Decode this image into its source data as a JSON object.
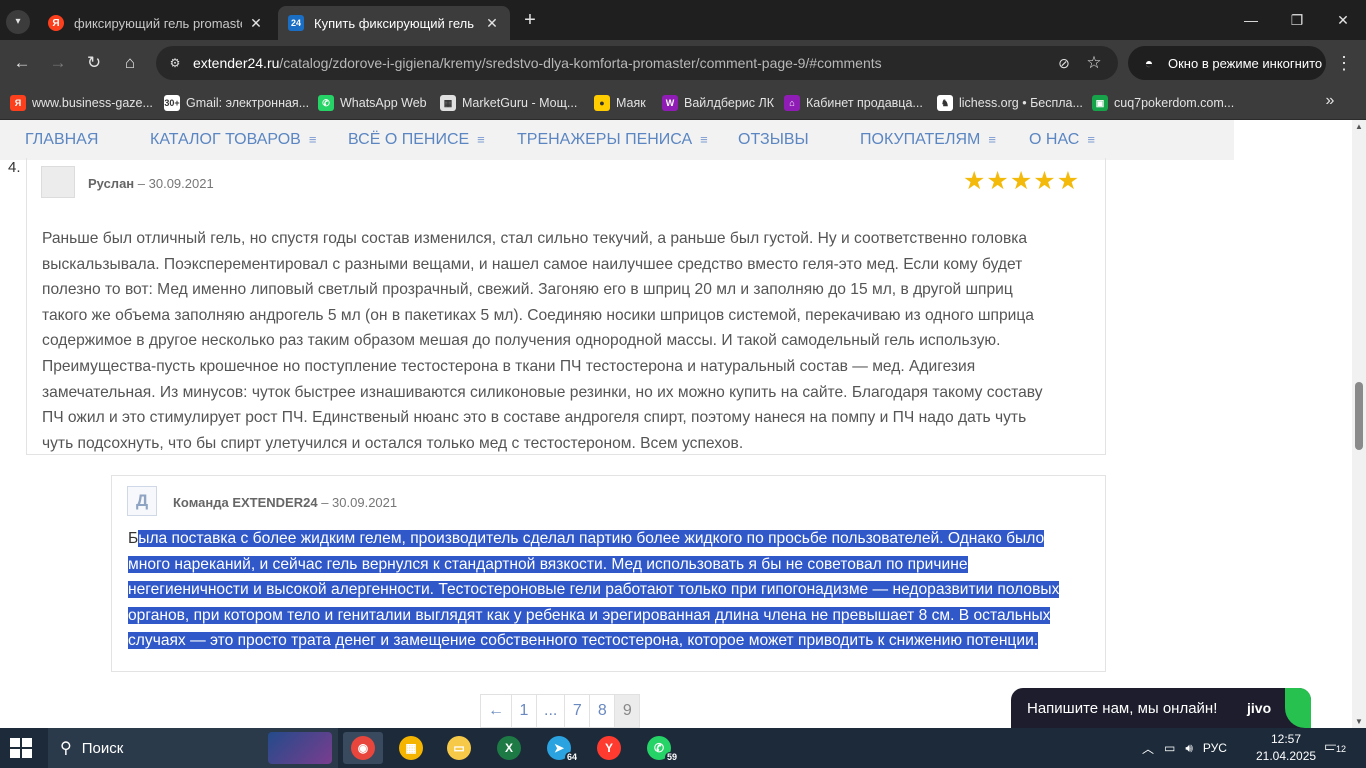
{
  "browser": {
    "tabs": [
      {
        "title": "фиксирующий гель promaster",
        "favicon": "Я",
        "active": false
      },
      {
        "title": "Купить фиксирующий гель Pro",
        "favicon": "24",
        "active": true
      }
    ],
    "new_tab": "+",
    "url_host": "extender24.ru",
    "url_path": "/catalog/zdorove-i-gigiena/kremy/sredstvo-dlya-komforta-promaster/comment-page-9/#comments",
    "incognito_label": "Окно в режиме инкогнито",
    "bookmarks": [
      {
        "label": "www.business-gaze...",
        "icon": "yandex-icon",
        "color": "#fc3f1d",
        "glyph": "Я"
      },
      {
        "label": "Gmail: электронная...",
        "icon": "gmail-icon",
        "color": "#ffffff",
        "glyph": "30+"
      },
      {
        "label": "WhatsApp Web",
        "icon": "whatsapp-icon",
        "color": "#25d366",
        "glyph": "✆"
      },
      {
        "label": "MarketGuru - Мощ...",
        "icon": "marketguru-icon",
        "color": "#e0e0e0",
        "glyph": "▦"
      },
      {
        "label": "Маяк",
        "icon": "mayak-icon",
        "color": "#ffcc00",
        "glyph": "●"
      },
      {
        "label": "Вайлдберис ЛК",
        "icon": "wildberries-icon",
        "color": "#8f1db5",
        "glyph": "W"
      },
      {
        "label": "Кабинет продавца...",
        "icon": "seller-cabinet-icon",
        "color": "#8f1db5",
        "glyph": "⌂"
      },
      {
        "label": "lichess.org • Беспла...",
        "icon": "lichess-icon",
        "color": "#ffffff",
        "glyph": "♞"
      },
      {
        "label": "cuq7pokerdom.com...",
        "icon": "pokerdom-icon",
        "color": "#16a34a",
        "glyph": "▣"
      }
    ]
  },
  "site": {
    "nav": [
      {
        "label": "ГЛАВНАЯ",
        "dd": false
      },
      {
        "label": "КАТАЛОГ ТОВАРОВ",
        "dd": true
      },
      {
        "label": "ВСЁ О ПЕНИСЕ",
        "dd": true
      },
      {
        "label": "ТРЕНАЖЕРЫ ПЕНИСА",
        "dd": true
      },
      {
        "label": "ОТЗЫВЫ",
        "dd": false
      },
      {
        "label": "ПОКУПАТЕЛЯМ",
        "dd": true
      },
      {
        "label": "О НАС",
        "dd": true
      }
    ],
    "dd_glyph": "≡"
  },
  "comment": {
    "number": "4.",
    "author": "Руслан",
    "date": "– 30.09.2021",
    "rating": 5,
    "star": "★",
    "lines": [
      "Раньше был отличный гель, но спустя годы состав изменился, стал сильно текучий, а раньше был густой. Ну и соответственно головка",
      "выскальзывала. Поэксперементировал с разными вещами, и нашел самое наилучшее средство вместо геля-это мед. Если кому будет",
      "полезно то вот: Мед именно липовый светлый прозрачный, свежий. Загоняю его в шприц 20 мл и заполняю до 15 мл, в другой шприц",
      "такого же объема заполняю андрогель 5 мл (он в пакетиках 5 мл). Соединяю носики шприцов системой, перекачиваю из одного шприца",
      "содержимое в другое несколько раз таким образом мешая до получения однородной массы. И такой самодельный гель использую.",
      "Преимущества-пусть крошечное но поступление тестостерона в ткани ПЧ тестостерона и натуральный состав — мед. Адигезия",
      "замечательная. Из минусов: чуток быстрее изнашиваются силиконовые резинки, но их можно купить на сайте. Благодаря такому составу",
      "ПЧ ожил и это стимулирует рост ПЧ. Единственый нюанс это в составе андрогеля спирт, поэтому нанеся на помпу и ПЧ надо дать чуть",
      "чуть подсохнуть, что бы спирт улетучился и остался только мед с тестостероном. Всем успехов."
    ]
  },
  "reply": {
    "avatar_letter": "Д",
    "author": "Команда EXTENDER24",
    "date": "– 30.09.2021",
    "first_char": "Б",
    "lines": [
      "ыла поставка с более жидким гелем, производитель сделал партию более жидкого по просьбе пользователей. Однако было",
      "много нареканий, и сейчас гель вернулся к стандартной вязкости. Мед использовать я бы не советовал по причине",
      "негегиеничности и высокой алергенности. Тестостероновые гели работают только при гипогонадизме — недоразвитии половых",
      "органов, при котором тело и гениталии выглядят как у ребенка и эрегированная длина члена не превышает 8 см. В остальных",
      "случаях — это просто трата денег и замещение собственного тестостерона, которое может приводить к снижению потенции."
    ],
    "selection_color": "#3058c9"
  },
  "pagination": [
    "←",
    "1",
    "...",
    "7",
    "8",
    "9"
  ],
  "pagination_current": "9",
  "chat_widget": {
    "text": "Напишите нам, мы онлайн!",
    "logo": "jivo"
  },
  "taskbar": {
    "search_placeholder": "Поиск",
    "apps": [
      {
        "name": "chrome-icon",
        "color": "#e8453c",
        "glyph": "◉",
        "badge": "",
        "active": true
      },
      {
        "name": "store-icon",
        "color": "#f5b400",
        "glyph": "▦",
        "badge": "",
        "active": false
      },
      {
        "name": "explorer-icon",
        "color": "#f7c948",
        "glyph": "▭",
        "badge": "",
        "active": false
      },
      {
        "name": "excel-icon",
        "color": "#1d7a45",
        "glyph": "X",
        "badge": "",
        "active": false
      },
      {
        "name": "telegram-icon",
        "color": "#2aa3e0",
        "glyph": "➤",
        "badge": "64",
        "active": false
      },
      {
        "name": "yandex-browser-icon",
        "color": "#ff3b30",
        "glyph": "Y",
        "badge": "",
        "active": false
      },
      {
        "name": "whatsapp-icon",
        "color": "#25d366",
        "glyph": "✆",
        "badge": "59",
        "active": false
      }
    ],
    "language": "РУС",
    "time": "12:57",
    "date": "21.04.2025",
    "notifications": "12"
  }
}
